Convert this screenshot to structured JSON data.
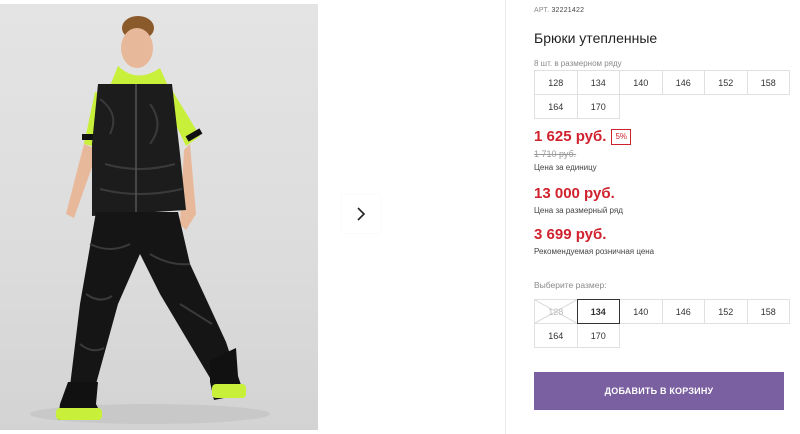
{
  "gallery": {
    "next_icon": "chevron-right-icon"
  },
  "product": {
    "art_label": "АРТ.",
    "art_number": "32221422",
    "title": "Брюки утепленные",
    "pcs_label": "8 шт. в размерном ряду",
    "size_row": [
      "128",
      "134",
      "140",
      "146",
      "152",
      "158",
      "164",
      "170"
    ]
  },
  "pricing": {
    "unit_price": "1 625 руб.",
    "discount": "5%",
    "old_price": "1 710 руб.",
    "unit_label": "Цена за единицу",
    "row_price": "13 000 руб.",
    "row_label": "Цена за размерный ряд",
    "rrp": "3 699 руб.",
    "rrp_label": "Рекомендуемая розничная цена"
  },
  "size_picker": {
    "label": "Выберите размер:",
    "options": [
      {
        "label": "128",
        "state": "disabled"
      },
      {
        "label": "134",
        "state": "selected"
      },
      {
        "label": "140",
        "state": "available"
      },
      {
        "label": "146",
        "state": "available"
      },
      {
        "label": "152",
        "state": "available"
      },
      {
        "label": "158",
        "state": "available"
      },
      {
        "label": "164",
        "state": "available"
      },
      {
        "label": "170",
        "state": "available"
      }
    ]
  },
  "cart_button": {
    "label": "ДОБАВИТЬ В КОРЗИНУ",
    "color": "#7a60a0"
  },
  "colors": {
    "price_red": "#d0222e"
  }
}
